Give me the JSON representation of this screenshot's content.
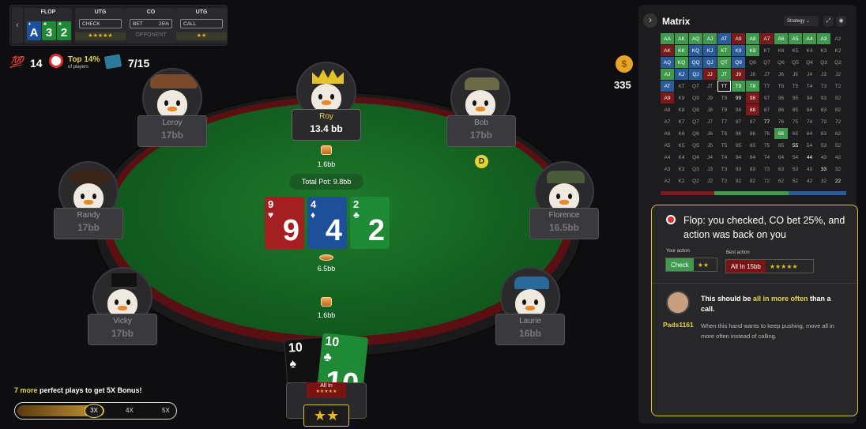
{
  "history": {
    "back": "‹",
    "streets": [
      {
        "title": "FLOP"
      },
      {
        "title": "UTG",
        "action": "CHECK",
        "sub": "★★★★★"
      },
      {
        "title": "CO",
        "action": "BET",
        "amt": "25%",
        "sub": "OPPONENT"
      },
      {
        "title": "UTG",
        "action": "CALL",
        "sub": "★★"
      }
    ],
    "flop_cards": [
      {
        "rank": "A",
        "suit": "♦"
      },
      {
        "rank": "3",
        "suit": "♣"
      },
      {
        "rank": "2",
        "suit": "♣"
      }
    ]
  },
  "stats": {
    "score": "14",
    "rank_title": "Top 14%",
    "rank_sub": "of players",
    "hands": "7/15",
    "coins": "335"
  },
  "seats": [
    {
      "name": "Leroy",
      "stack": "17bb"
    },
    {
      "name": "Roy",
      "stack": "13.4 bb"
    },
    {
      "name": "Bob",
      "stack": "17bb"
    },
    {
      "name": "Randy",
      "stack": "17bb"
    },
    {
      "name": "Florence",
      "stack": "16.5bb"
    },
    {
      "name": "Vicky",
      "stack": "17bb"
    },
    {
      "name": "Laurie",
      "stack": "16bb"
    }
  ],
  "table": {
    "pot": "Total Pot: 9.8bb",
    "bet_top": "1.6bb",
    "bet_mid": "6.5bb",
    "bet_bottom": "1.6bb",
    "dealer": "D",
    "board": [
      {
        "rank": "9",
        "suit": "♥",
        "color": "#a31f22"
      },
      {
        "rank": "4",
        "suit": "♦",
        "color": "#1d4f9a"
      },
      {
        "rank": "2",
        "suit": "♣",
        "color": "#1f8a35"
      }
    ],
    "hero_cards": [
      {
        "rank": "10",
        "suit": "♠",
        "color": "#111"
      },
      {
        "rank": "10",
        "suit": "♣",
        "color": "#1f8a35"
      }
    ],
    "hero_action": "All In",
    "hero_stars": "★★★★★",
    "hero_rating": "★★"
  },
  "bonus": {
    "text_prefix": "7 more",
    "text_suffix": " perfect plays to get 5X Bonus!",
    "m3": "3X",
    "m4": "4X",
    "m5": "5X",
    "progress": 0.55
  },
  "panel": {
    "title": "Matrix",
    "expand": "›",
    "dropdown": "Strategy",
    "coach_title": "Flop: you checked, CO bet 25%, and action was back on you",
    "your_action_label": "Your action",
    "your_action": "Check",
    "your_stars": "★★",
    "best_action_label": "Best action",
    "best_action": "All In 15bb",
    "best_stars": "★★★★★",
    "pro_name": "Pads1161",
    "msg_prefix": "This should be ",
    "msg_hl": "all in more often",
    "msg_suffix": " than a call.",
    "msg_body": "When this hand wants to keep pushing, move all in more often instead of calling."
  },
  "matrix": {
    "rows": [
      [
        "AA",
        "AK",
        "AQ",
        "AJ",
        "AT",
        "A9",
        "A8",
        "A7",
        "A6",
        "A5",
        "A4",
        "A3",
        "A2"
      ],
      [
        "AK",
        "KK",
        "KQ",
        "KJ",
        "KT",
        "K9",
        "K8",
        "K7",
        "K6",
        "K5",
        "K4",
        "K3",
        "K2"
      ],
      [
        "AQ",
        "KQ",
        "QQ",
        "QJ",
        "QT",
        "Q9",
        "Q8",
        "Q7",
        "Q6",
        "Q5",
        "Q4",
        "Q3",
        "Q2"
      ],
      [
        "AJ",
        "KJ",
        "QJ",
        "JJ",
        "JT",
        "J9",
        "J8",
        "J7",
        "J6",
        "J5",
        "J4",
        "J3",
        "J2"
      ],
      [
        "AT",
        "KT",
        "QT",
        "JT",
        "TT",
        "T9",
        "T8",
        "T7",
        "T6",
        "T5",
        "T4",
        "T3",
        "T2"
      ],
      [
        "A9",
        "K9",
        "Q9",
        "J9",
        "T9",
        "99",
        "98",
        "97",
        "96",
        "95",
        "94",
        "93",
        "92"
      ],
      [
        "A8",
        "K8",
        "Q8",
        "J8",
        "T8",
        "98",
        "88",
        "87",
        "86",
        "85",
        "84",
        "83",
        "82"
      ],
      [
        "A7",
        "K7",
        "Q7",
        "J7",
        "T7",
        "97",
        "87",
        "77",
        "76",
        "75",
        "74",
        "73",
        "72"
      ],
      [
        "A6",
        "K6",
        "Q6",
        "J6",
        "T6",
        "96",
        "86",
        "76",
        "66",
        "65",
        "64",
        "63",
        "62"
      ],
      [
        "A5",
        "K5",
        "Q5",
        "J5",
        "T5",
        "95",
        "85",
        "75",
        "65",
        "55",
        "54",
        "53",
        "52"
      ],
      [
        "A4",
        "K4",
        "Q4",
        "J4",
        "T4",
        "94",
        "84",
        "74",
        "64",
        "54",
        "44",
        "43",
        "42"
      ],
      [
        "A3",
        "K3",
        "Q3",
        "J3",
        "T3",
        "93",
        "83",
        "73",
        "63",
        "53",
        "43",
        "33",
        "32"
      ],
      [
        "A2",
        "K2",
        "Q2",
        "J2",
        "T2",
        "92",
        "82",
        "72",
        "62",
        "52",
        "42",
        "32",
        "22"
      ]
    ],
    "colors": [
      "ggggbrgrggggn",
      "rgbbgbgnnnnnn",
      "bgbbgbnnnnnnn",
      "gbbrgrnnnnnnn",
      "bnnnTggnnnnnn",
      "rnnnnwrnnnnnn",
      "nnnnnnrnnnnnn",
      "nnnnnnnwnnnnn",
      "nnnnnnnngnnnn",
      "nnnnnnnnnwnnn",
      "nnnnnnnnnnwnn",
      "nnnnnnnnnnnwn",
      "nnnnnnnnnnnnw"
    ]
  }
}
